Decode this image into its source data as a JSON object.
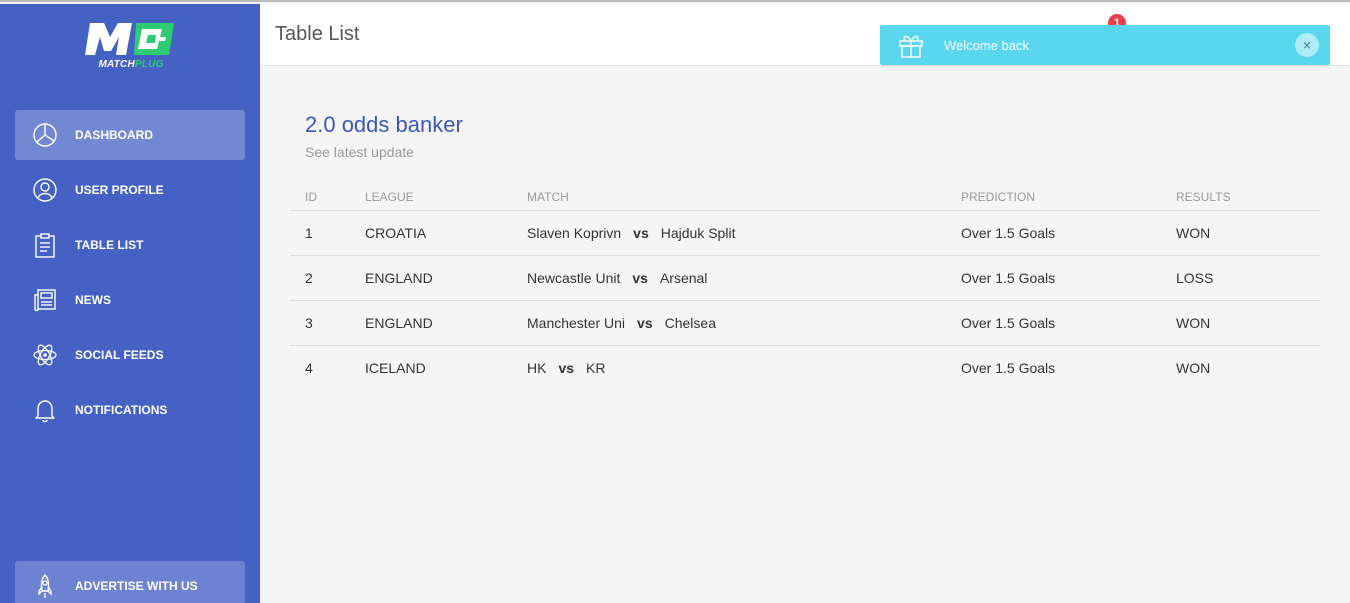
{
  "brand": {
    "logo_mark": "MP",
    "name_part1": "MATCH",
    "name_part2": "PLUG",
    "accent_color": "#2ecc71"
  },
  "sidebar": {
    "items": [
      {
        "label": "DASHBOARD",
        "icon": "pie-chart-icon",
        "active": true
      },
      {
        "label": "USER PROFILE",
        "icon": "user-icon",
        "active": false
      },
      {
        "label": "TABLE LIST",
        "icon": "clipboard-icon",
        "active": false
      },
      {
        "label": "NEWS",
        "icon": "newspaper-icon",
        "active": false
      },
      {
        "label": "SOCIAL FEEDS",
        "icon": "atom-icon",
        "active": false
      },
      {
        "label": "NOTIFICATIONS",
        "icon": "bell-icon",
        "active": false
      }
    ],
    "advertise": {
      "label": "ADVERTISE WITH US",
      "icon": "rocket-icon"
    }
  },
  "header": {
    "title": "Table List",
    "notification_count": "1"
  },
  "toast": {
    "message": "Welcome back",
    "icon": "gift-icon",
    "close": "×"
  },
  "card": {
    "title": "2.0 odds banker",
    "subtitle": "See latest update",
    "columns": [
      "ID",
      "LEAGUE",
      "MATCH",
      "PREDICTION",
      "RESULTS"
    ],
    "rows": [
      {
        "id": "1",
        "league": "CROATIA",
        "home": "Slaven Koprivn",
        "vs": "vs",
        "away": "Hajduk Split",
        "prediction": "Over 1.5 Goals",
        "result": "WON"
      },
      {
        "id": "2",
        "league": "ENGLAND",
        "home": "Newcastle Unit",
        "vs": "vs",
        "away": "Arsenal",
        "prediction": "Over 1.5 Goals",
        "result": "LOSS"
      },
      {
        "id": "3",
        "league": "ENGLAND",
        "home": "Manchester Uni",
        "vs": "vs",
        "away": "Chelsea",
        "prediction": "Over 1.5 Goals",
        "result": "WON"
      },
      {
        "id": "4",
        "league": "ICELAND",
        "home": "HK",
        "vs": "vs",
        "away": "KR",
        "prediction": "Over 1.5 Goals",
        "result": "WON"
      }
    ]
  },
  "colors": {
    "sidebar": "#4561c4",
    "title_accent": "#3b58b8",
    "toast": "#5ad7ee",
    "badge": "#e5404a"
  }
}
